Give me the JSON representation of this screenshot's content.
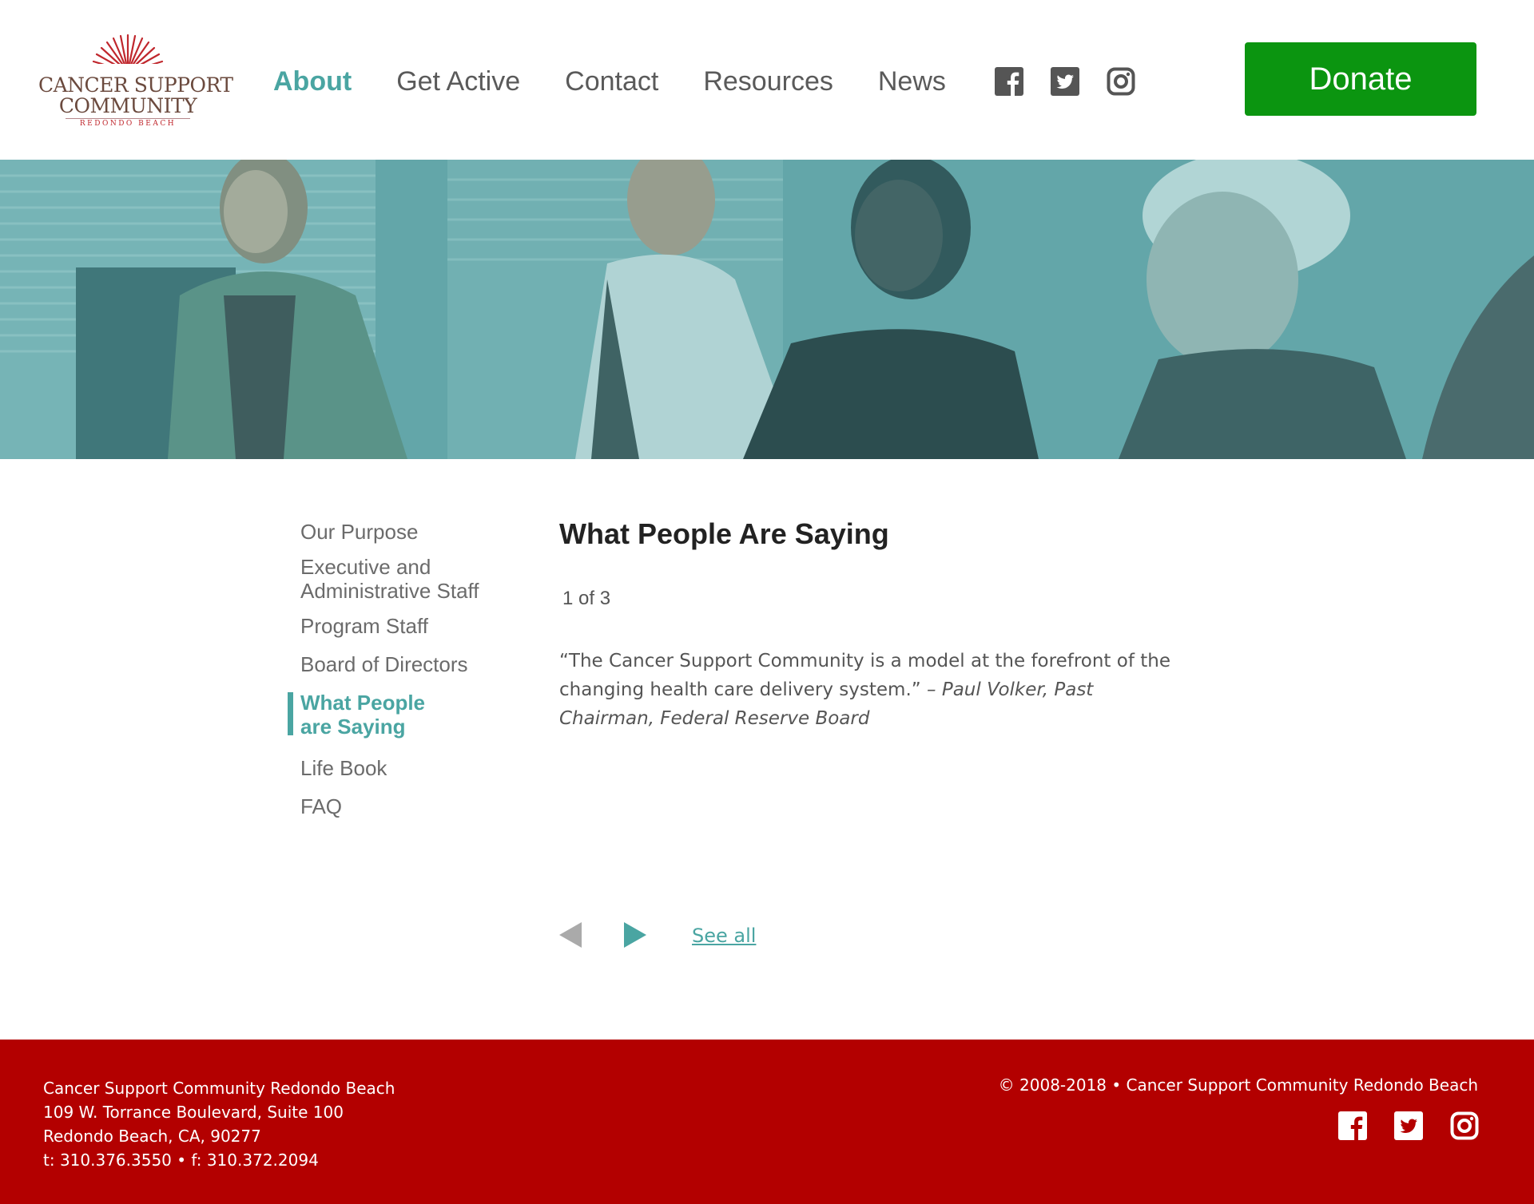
{
  "header": {
    "logo": {
      "line1": "CANCER SUPPORT",
      "line2": "COMMUNITY",
      "sub": "REDONDO BEACH",
      "sun_color": "#c0272d",
      "text_color": "#6b4a3e"
    },
    "nav": [
      {
        "label": "About",
        "active": true
      },
      {
        "label": "Get Active",
        "active": false
      },
      {
        "label": "Contact",
        "active": false
      },
      {
        "label": "Resources",
        "active": false
      },
      {
        "label": "News",
        "active": false
      }
    ],
    "social_icons": [
      "facebook-icon",
      "twitter-icon",
      "instagram-icon"
    ],
    "donate_label": "Donate"
  },
  "colors": {
    "accent": "#4aa5a2",
    "donate_green": "#0b9510",
    "footer_red": "#b30000",
    "nav_text": "#5a5a5a"
  },
  "sidebar": {
    "items": [
      {
        "label": "Our Purpose",
        "active": false
      },
      {
        "label": "Executive and Administrative Staff",
        "active": false
      },
      {
        "label": "Program Staff",
        "active": false
      },
      {
        "label": "Board of Directors",
        "active": false
      },
      {
        "label": "What People are Saying",
        "active": true
      },
      {
        "label": "Life Book",
        "active": false
      },
      {
        "label": "FAQ",
        "active": false
      }
    ]
  },
  "main": {
    "title": "What People Are Saying",
    "counter": "1 of 3",
    "quote_text": "“The Cancer Support Community is a model at the forefront of the changing health care delivery system.”",
    "quote_attribution": "– Paul Volker, Past Chairman, Federal Reserve Board",
    "see_all_label": "See all"
  },
  "footer": {
    "address": {
      "name": "Cancer Support Community Redondo Beach",
      "street": "109 W. Torrance Boulevard, Suite 100",
      "city": "Redondo Beach, CA, 90277",
      "phone": "t: 310.376.3550 • f: 310.372.2094"
    },
    "copyright": "© 2008-2018 • Cancer Support Community Redondo Beach"
  }
}
